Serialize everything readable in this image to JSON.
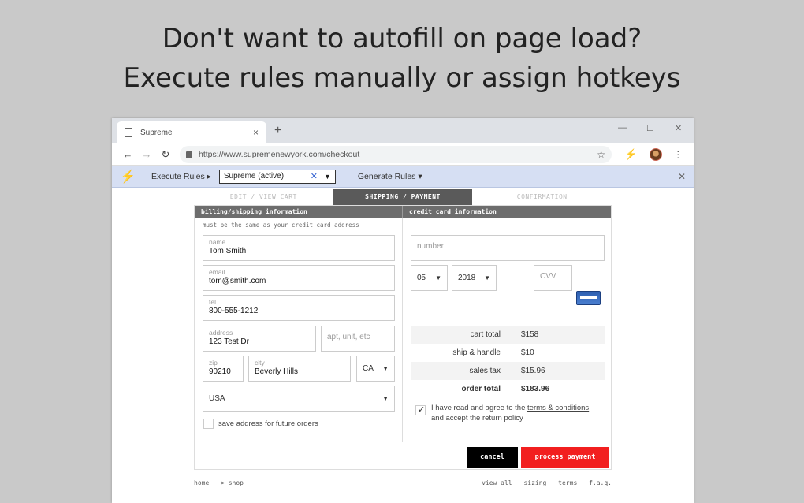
{
  "headline": {
    "line1": "Don't want to autofill on page load?",
    "line2": "Execute rules manually or assign hotkeys"
  },
  "browser": {
    "tab_title": "Supreme",
    "tab_close": "×",
    "new_tab": "+",
    "minimize": "—",
    "maximize": "☐",
    "close": "✕",
    "back": "←",
    "forward": "→",
    "reload": "↻",
    "url": "https://www.supremenewyork.com/checkout",
    "star": "☆",
    "menu": "⋮"
  },
  "extension_bar": {
    "execute_label": "Execute Rules ▸",
    "rule_value": "Supreme (active)",
    "clear": "✕",
    "dropdown": "▼",
    "generate_label": "Generate Rules ▾",
    "close": "✕"
  },
  "checkout": {
    "steps": [
      "EDIT / VIEW CART",
      "SHIPPING / PAYMENT",
      "CONFIRMATION"
    ],
    "billing_header": "billing/shipping information",
    "card_header": "credit card information",
    "note": "must be the same as your credit card address",
    "name_label": "name",
    "name_value": "Tom Smith",
    "email_label": "email",
    "email_value": "tom@smith.com",
    "tel_label": "tel",
    "tel_value": "800-555-1212",
    "address_label": "address",
    "address_value": "123 Test Dr",
    "apt_placeholder": "apt, unit, etc",
    "zip_label": "zip",
    "zip_value": "90210",
    "city_label": "city",
    "city_value": "Beverly Hills",
    "state_value": "CA",
    "country_value": "USA",
    "save_address_label": "save address for future orders",
    "number_placeholder": "number",
    "exp_month": "05",
    "exp_year": "2018",
    "cvv_placeholder": "CVV",
    "totals": [
      {
        "label": "cart total",
        "value": "$158"
      },
      {
        "label": "ship & handle",
        "value": "$10"
      },
      {
        "label": "sales tax",
        "value": "$15.96"
      },
      {
        "label": "order total",
        "value": "$183.96"
      }
    ],
    "agree_pre": "I have read and agree to the ",
    "agree_link": "terms & conditions",
    "agree_post": ",",
    "agree_line2": "and accept the return policy",
    "cancel_label": "cancel",
    "pay_label": "process payment"
  },
  "footer": {
    "left": [
      "home",
      "> shop"
    ],
    "right": [
      "view all",
      "sizing",
      "terms",
      "f.a.q."
    ]
  }
}
